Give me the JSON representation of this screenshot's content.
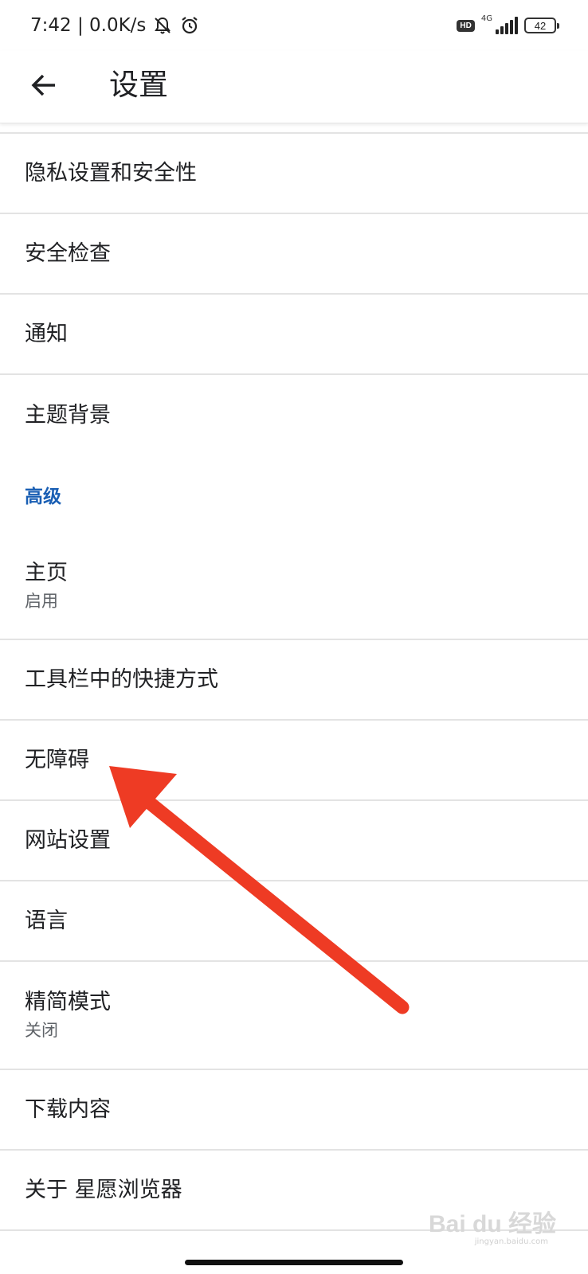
{
  "status_bar": {
    "time_speed": "7:42 | 0.0K/s",
    "network": "4G",
    "hd": "HD",
    "battery": "42"
  },
  "app_bar": {
    "title": "设置",
    "back_icon": "arrow-left-icon"
  },
  "items_top": [
    {
      "label": "隐私设置和安全性"
    },
    {
      "label": "安全检查"
    },
    {
      "label": "通知"
    },
    {
      "label": "主题背景"
    }
  ],
  "section_advanced": "高级",
  "items_advanced": [
    {
      "label": "主页",
      "sub": "启用"
    },
    {
      "label": "工具栏中的快捷方式"
    },
    {
      "label": "无障碍"
    },
    {
      "label": "网站设置"
    },
    {
      "label": "语言"
    },
    {
      "label": "精简模式",
      "sub": "关闭"
    },
    {
      "label": "下载内容"
    },
    {
      "label": "关于 星愿浏览器"
    }
  ],
  "watermark": {
    "brand": "Bai du 经验",
    "url": "jingyan.baidu.com"
  },
  "colors": {
    "accent": "#1a5fb4",
    "annotation_arrow": "#ee3b24",
    "divider": "#e3e3e3"
  }
}
